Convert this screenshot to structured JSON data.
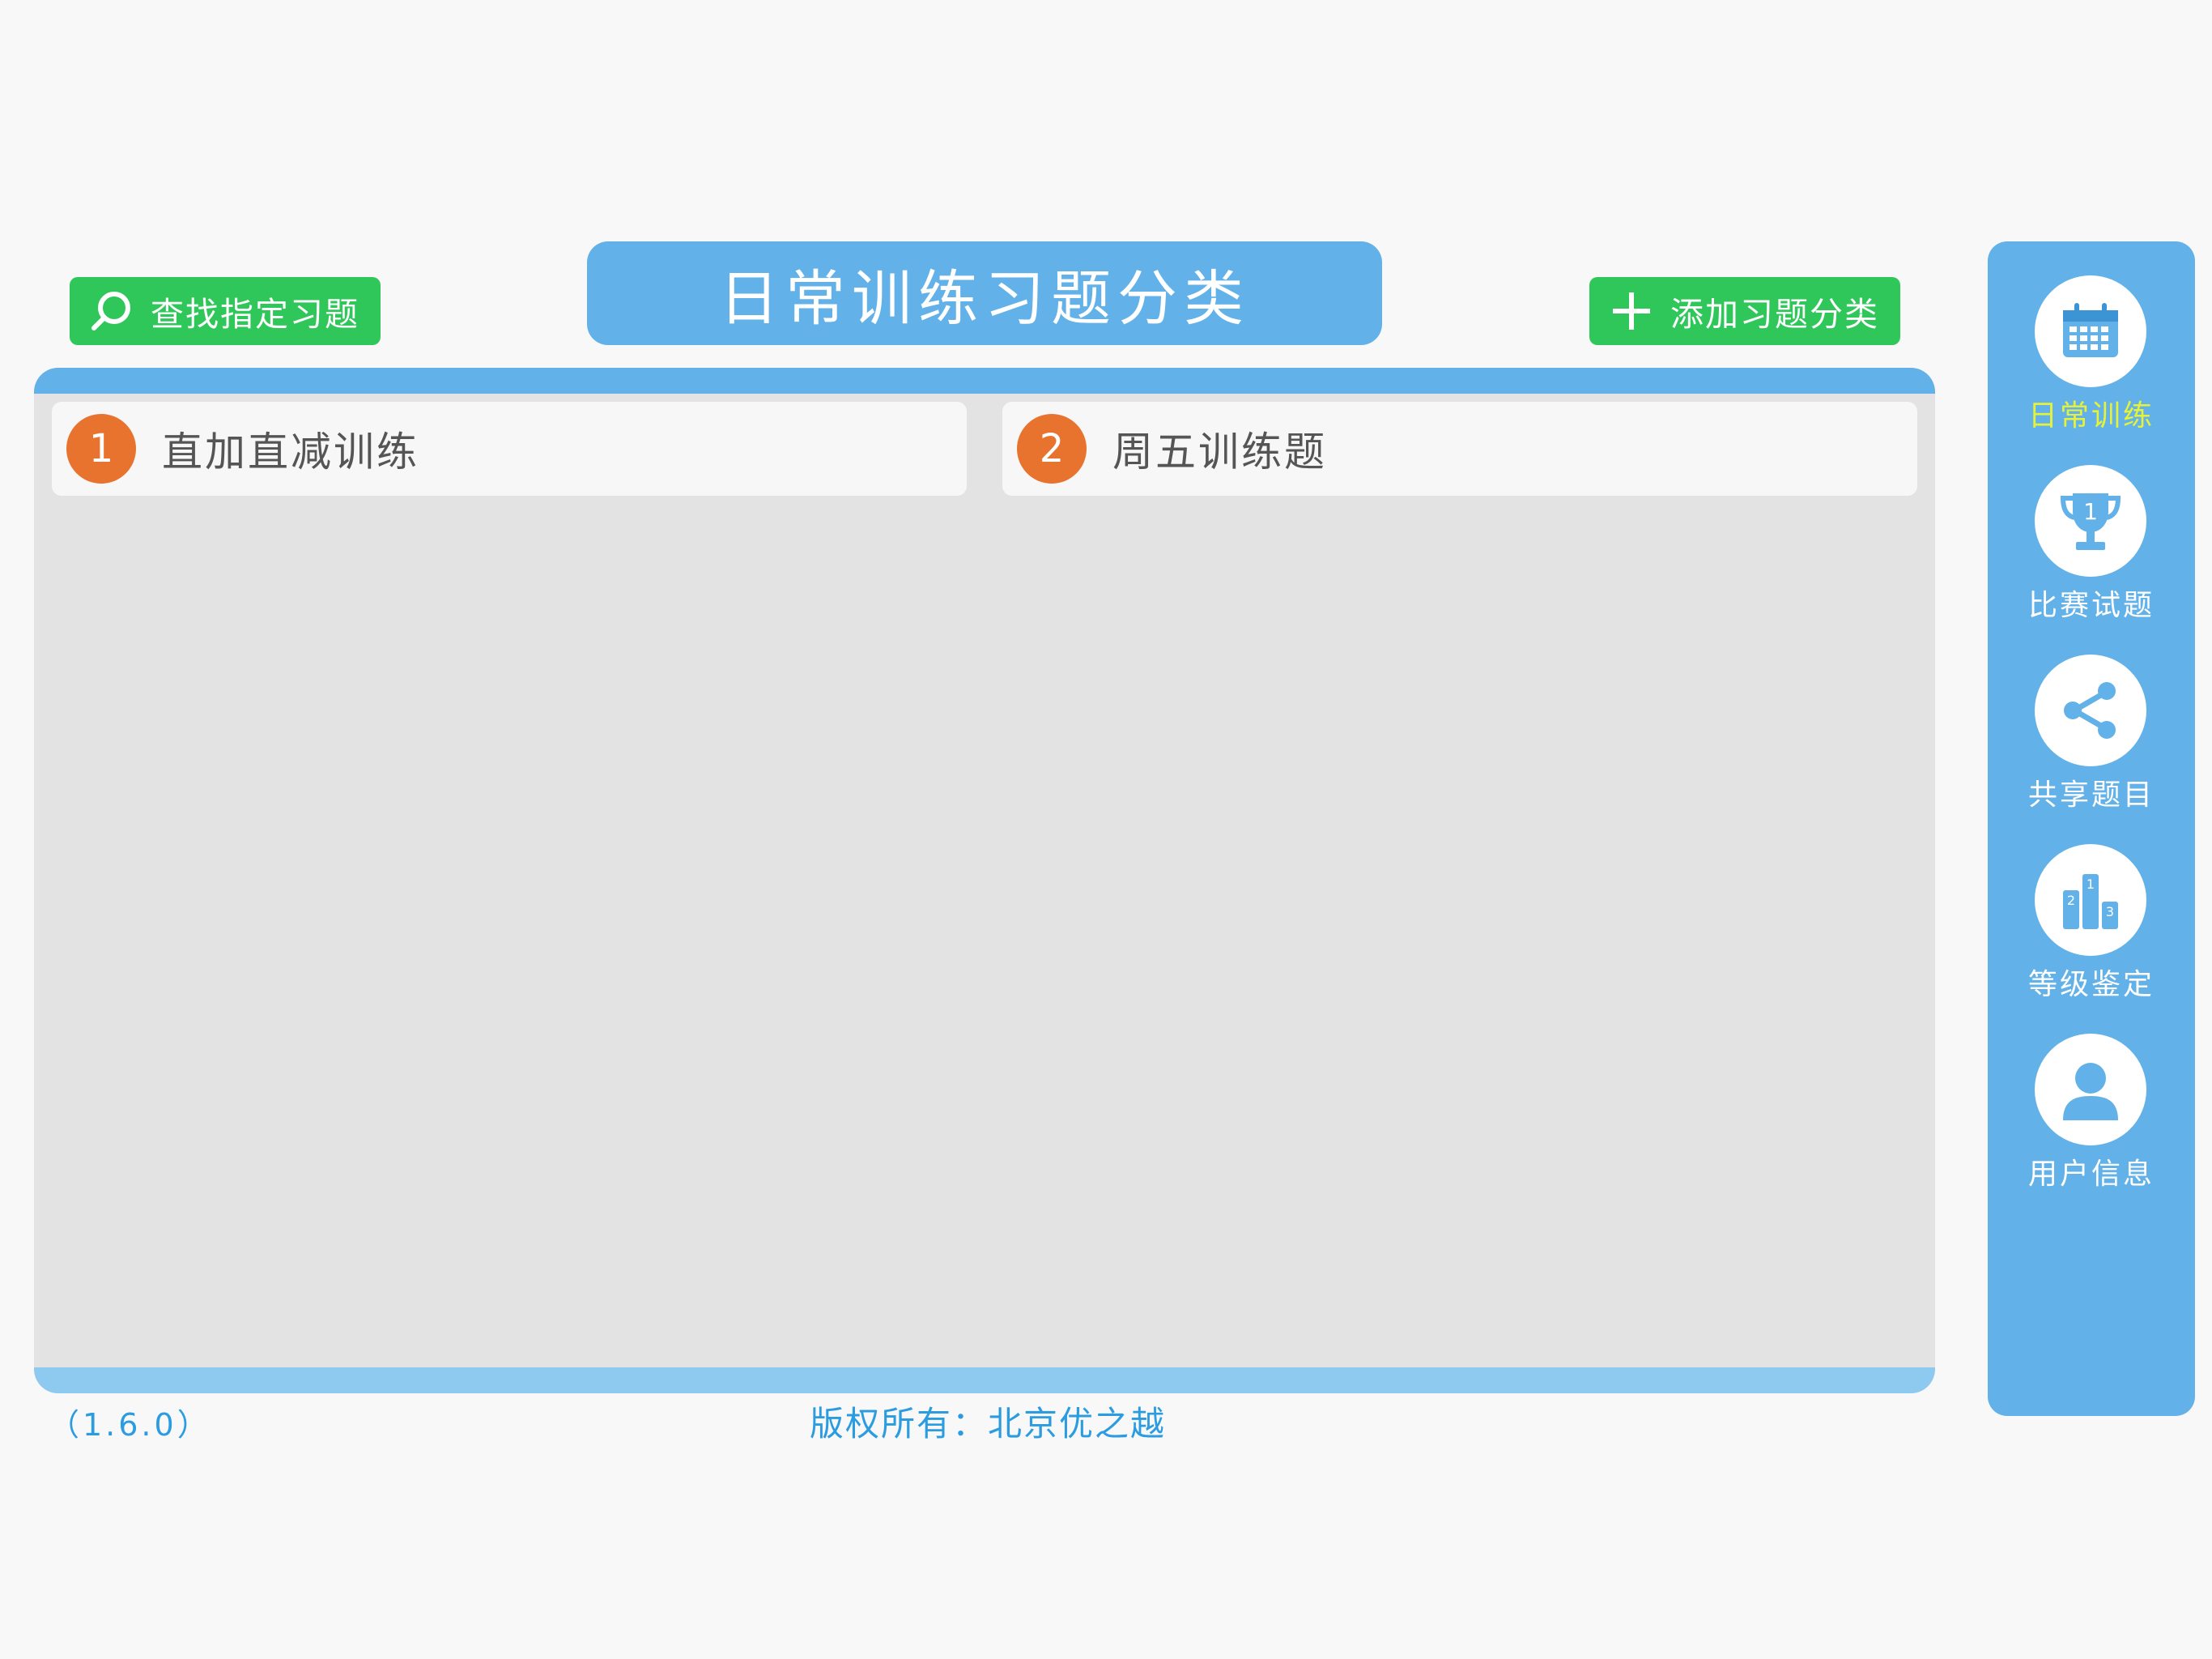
{
  "header": {
    "title": "日常训练习题分类",
    "search_label": "查找指定习题",
    "add_label": "添加习题分类"
  },
  "categories": [
    {
      "number": "1",
      "label": "直加直减训练"
    },
    {
      "number": "2",
      "label": "周五训练题"
    }
  ],
  "footer": {
    "version": "（1.6.0）",
    "copyright": "版权所有：北京优之越"
  },
  "sidebar": {
    "items": [
      {
        "label": "日常训练",
        "icon": "calendar-icon",
        "active": true
      },
      {
        "label": "比赛试题",
        "icon": "trophy-icon"
      },
      {
        "label": "共享题目",
        "icon": "share-icon"
      },
      {
        "label": "等级鉴定",
        "icon": "podium-icon"
      },
      {
        "label": "用户信息",
        "icon": "user-icon"
      }
    ]
  },
  "colors": {
    "accent_blue": "#62b1e8",
    "green": "#2fc75a",
    "orange": "#e8732e",
    "active_nav": "#e6f23a"
  }
}
